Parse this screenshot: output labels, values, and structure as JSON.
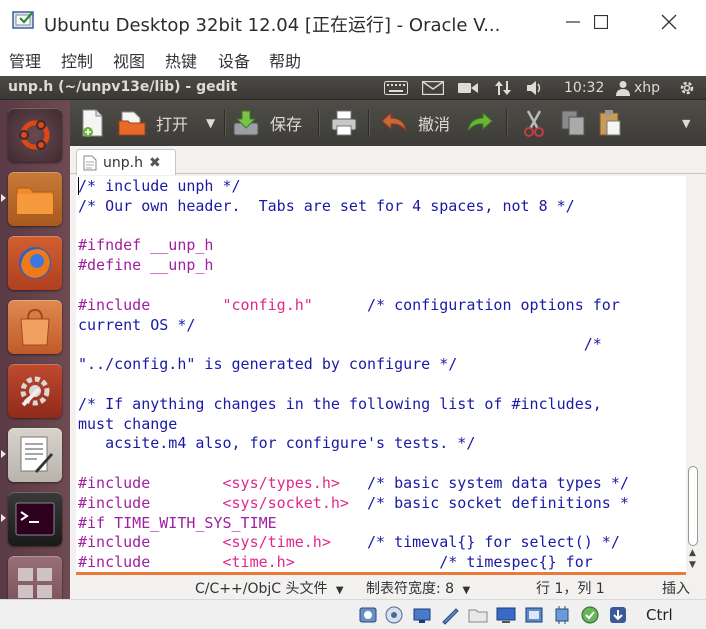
{
  "host": {
    "title": "Ubuntu Desktop 32bit 12.04 [正在运行] - Oracle V...",
    "menu": [
      "管理",
      "控制",
      "视图",
      "热键",
      "设备",
      "帮助"
    ],
    "host_key": "Ctrl"
  },
  "panel": {
    "window_title": "unp.h (~/unpv13e/lib) - gedit",
    "clock": "10:32",
    "user": "xhp"
  },
  "toolbar": {
    "open_label": "打开",
    "save_label": "保存",
    "undo_label": "撤消"
  },
  "tab": {
    "name": "unp.h"
  },
  "code": [
    [
      [
        "c-comment",
        "/* include unph */"
      ]
    ],
    [
      [
        "c-comment",
        "/* Our own header.  Tabs are set for 4 spaces, not 8 */"
      ]
    ],
    [],
    [
      [
        "c-pre",
        "#ifndef __unp_h"
      ]
    ],
    [
      [
        "c-pre",
        "#define __unp_h"
      ]
    ],
    [],
    [
      [
        "c-pre",
        "#include"
      ],
      [
        "",
        "        "
      ],
      [
        "c-str",
        "\"config.h\""
      ],
      [
        "",
        "      "
      ],
      [
        "c-comment",
        "/* configuration options for"
      ]
    ],
    [
      [
        "c-comment",
        "current OS */"
      ]
    ],
    [
      [
        "",
        "                                                        "
      ],
      [
        "c-comment",
        "/*"
      ]
    ],
    [
      [
        "c-comment",
        "\"../config.h\" is generated by configure */"
      ]
    ],
    [],
    [
      [
        "c-comment",
        "/* If anything changes in the following list of #includes,"
      ]
    ],
    [
      [
        "c-comment",
        "must change"
      ]
    ],
    [
      [
        "c-comment",
        "   acsite.m4 also, for configure's tests. */"
      ]
    ],
    [],
    [
      [
        "c-pre",
        "#include"
      ],
      [
        "",
        "        "
      ],
      [
        "c-str",
        "<sys/types.h>"
      ],
      [
        "",
        "   "
      ],
      [
        "c-comment",
        "/* basic system data types */"
      ]
    ],
    [
      [
        "c-pre",
        "#include"
      ],
      [
        "",
        "        "
      ],
      [
        "c-str",
        "<sys/socket.h>"
      ],
      [
        "",
        "  "
      ],
      [
        "c-comment",
        "/* basic socket definitions *"
      ]
    ],
    [
      [
        "c-pre",
        "#if TIME_WITH_SYS_TIME"
      ]
    ],
    [
      [
        "c-pre",
        "#include"
      ],
      [
        "",
        "        "
      ],
      [
        "c-str",
        "<sys/time.h>"
      ],
      [
        "",
        "    "
      ],
      [
        "c-comment",
        "/* timeval{} for select() */"
      ]
    ],
    [
      [
        "c-pre",
        "#include"
      ],
      [
        "",
        "        "
      ],
      [
        "c-str",
        "<time.h>"
      ],
      [
        "",
        "                "
      ],
      [
        "c-comment",
        "/* timespec{} for"
      ]
    ]
  ],
  "statusbar": {
    "language": "C/C++/ObjC 头文件",
    "tab_width": "制表符宽度: 8",
    "position": "行 1，列 1",
    "mode": "插入"
  },
  "colors": {
    "ubuntu_orange": "#dd4814",
    "comment": "#1a1aa6",
    "preprocessor": "#a020a0",
    "string": "#e0288b"
  }
}
